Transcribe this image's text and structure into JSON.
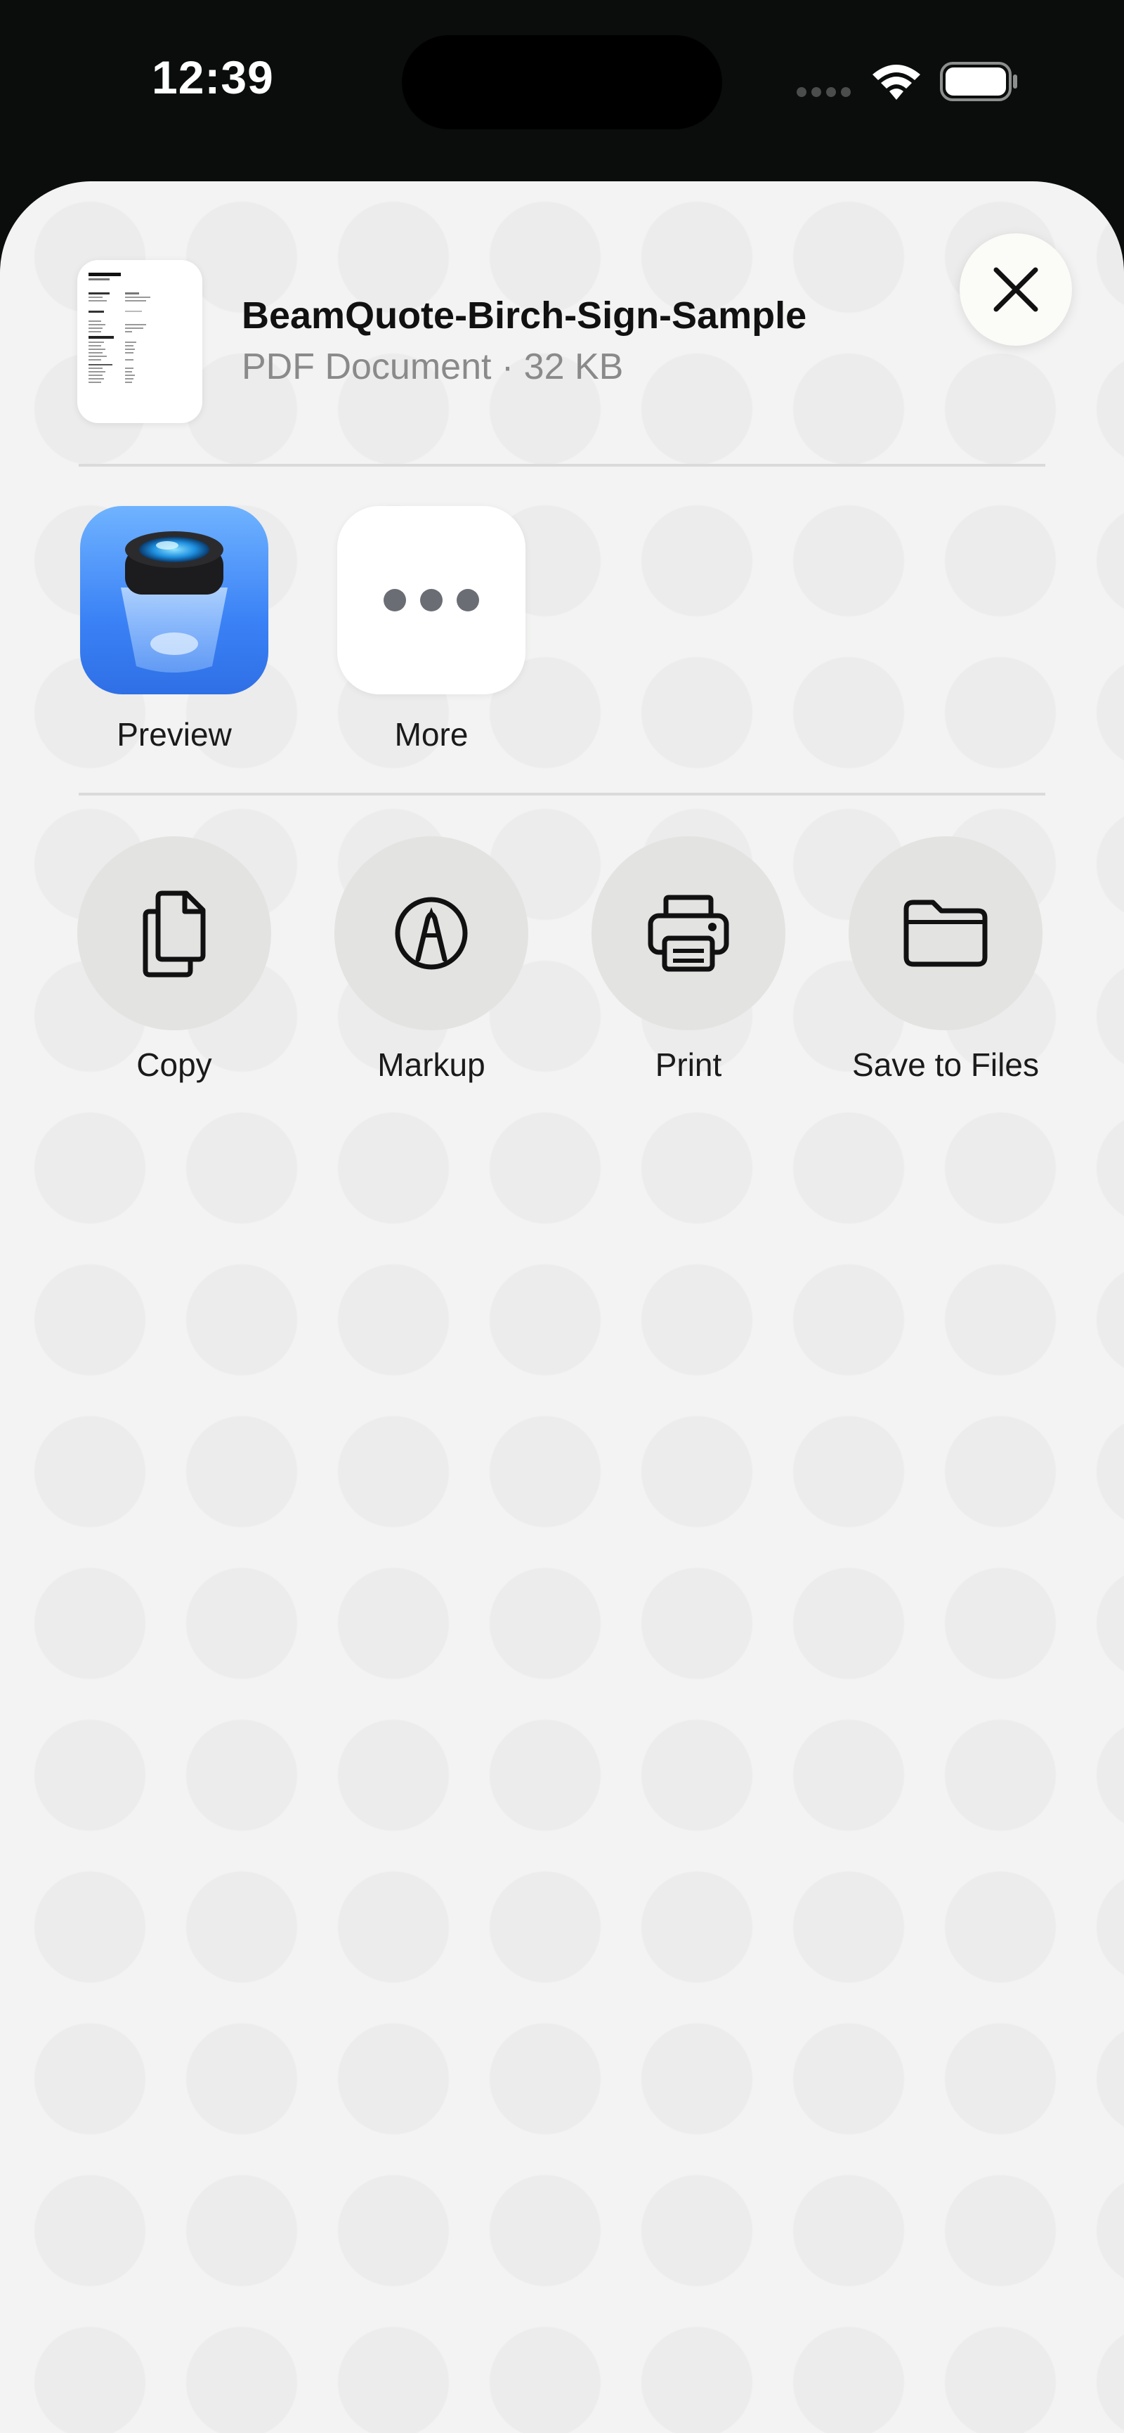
{
  "status_bar": {
    "time": "12:39"
  },
  "share_sheet": {
    "document": {
      "title": "BeamQuote-Birch-Sign-Sample",
      "subtitle": "PDF Document · 32 KB"
    },
    "apps": [
      {
        "label": "Preview",
        "icon": "preview-app-icon"
      },
      {
        "label": "More",
        "icon": "ellipsis-icon"
      }
    ],
    "actions": [
      {
        "label": "Copy",
        "icon": "copy-icon"
      },
      {
        "label": "Markup",
        "icon": "markup-pen-icon"
      },
      {
        "label": "Print",
        "icon": "printer-icon"
      },
      {
        "label": "Save to Files",
        "icon": "folder-icon"
      }
    ]
  },
  "colors": {
    "sheet_background": "#f2f3f2",
    "status_background": "#0a0d0c",
    "preview_blue": "#3b82f6",
    "action_circle": "#e3e4e2"
  }
}
